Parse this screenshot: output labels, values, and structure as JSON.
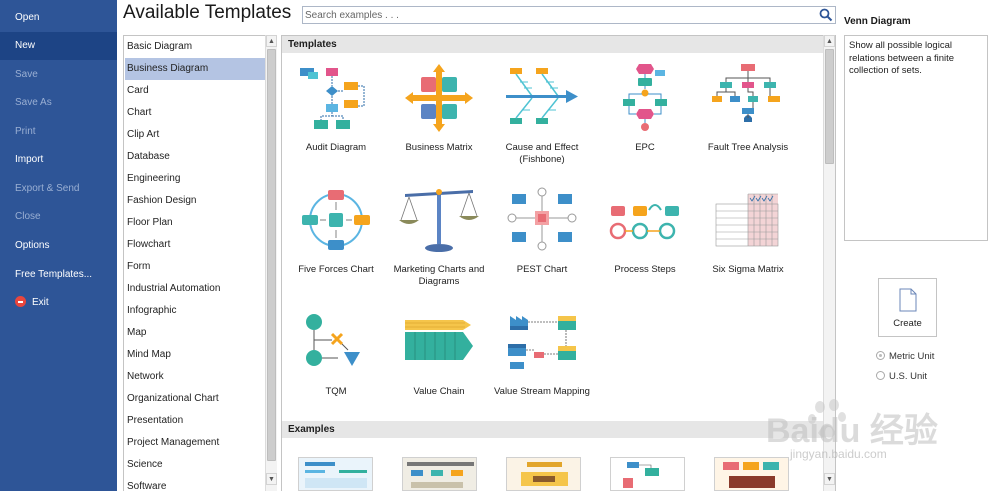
{
  "leftnav": {
    "items": [
      {
        "label": "Open",
        "state": "normal"
      },
      {
        "label": "New",
        "state": "active"
      },
      {
        "label": "Save",
        "state": "disabled"
      },
      {
        "label": "Save As",
        "state": "disabled"
      },
      {
        "label": "Print",
        "state": "disabled"
      },
      {
        "label": "Import",
        "state": "normal"
      },
      {
        "label": "Export & Send",
        "state": "disabled"
      },
      {
        "label": "Close",
        "state": "disabled"
      },
      {
        "label": "Options",
        "state": "normal"
      },
      {
        "label": "Free Templates...",
        "state": "normal"
      },
      {
        "label": "Exit",
        "state": "normal",
        "icon": "exit-icon"
      }
    ]
  },
  "title": "Available Templates",
  "search": {
    "placeholder": "Search examples . . .",
    "icon": "search-icon"
  },
  "categories": [
    "Basic Diagram",
    "Business Diagram",
    "Card",
    "Chart",
    "Clip Art",
    "Database",
    "Engineering",
    "Fashion Design",
    "Floor Plan",
    "Flowchart",
    "Form",
    "Industrial Automation",
    "Infographic",
    "Map",
    "Mind Map",
    "Network",
    "Organizational Chart",
    "Presentation",
    "Project Management",
    "Science",
    "Software"
  ],
  "selected_category": "Business Diagram",
  "gallery": {
    "templates_heading": "Templates",
    "examples_heading": "Examples",
    "templates": [
      {
        "label": "Audit Diagram",
        "icon": "audit-diagram-icon"
      },
      {
        "label": "Business Matrix",
        "icon": "business-matrix-icon"
      },
      {
        "label": "Cause and Effect (Fishbone)",
        "icon": "fishbone-icon"
      },
      {
        "label": "EPC",
        "icon": "epc-icon"
      },
      {
        "label": "Fault Tree Analysis",
        "icon": "fault-tree-icon"
      },
      {
        "label": "Five Forces Chart",
        "icon": "five-forces-icon"
      },
      {
        "label": "Marketing Charts and Diagrams",
        "icon": "scales-icon"
      },
      {
        "label": "PEST Chart",
        "icon": "pest-chart-icon"
      },
      {
        "label": "Process Steps",
        "icon": "process-steps-icon"
      },
      {
        "label": "Six Sigma Matrix",
        "icon": "six-sigma-icon"
      },
      {
        "label": "TQM",
        "icon": "tqm-icon"
      },
      {
        "label": "Value Chain",
        "icon": "value-chain-icon"
      },
      {
        "label": "Value Stream Mapping",
        "icon": "value-stream-icon"
      }
    ]
  },
  "details": {
    "title": "Venn Diagram",
    "description": "Show all possible logical relations between a finite collection of sets.",
    "create_label": "Create",
    "units": [
      {
        "label": "Metric Unit",
        "selected": true
      },
      {
        "label": "U.S. Unit",
        "selected": false
      }
    ]
  },
  "watermark": {
    "text": "Baidu 经验",
    "url_text": "jingyan.baidu.com"
  },
  "colors": {
    "nav_bg": "#2e5597",
    "nav_active": "#1d4485",
    "selection": "#b4c4e3",
    "section_header": "#e6e6e6"
  }
}
